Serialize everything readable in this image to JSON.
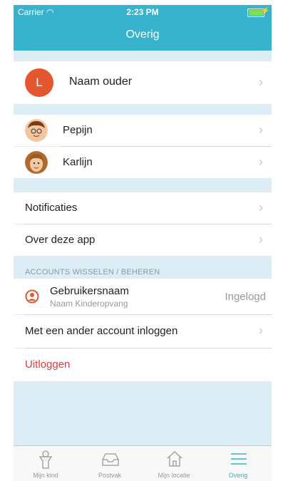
{
  "status_bar": {
    "carrier": "Carrier",
    "time": "2:23 PM"
  },
  "nav": {
    "title": "Overig"
  },
  "profile": {
    "initial": "L",
    "name": "Naam ouder"
  },
  "children": [
    {
      "name": "Pepijn",
      "avatar": "boy-avatar"
    },
    {
      "name": "Karlijn",
      "avatar": "girl-avatar"
    }
  ],
  "menu": {
    "notifications": "Notificaties",
    "about": "Over deze app"
  },
  "accounts": {
    "header": "ACCOUNTS WISSELEN / BEHEREN",
    "username": "Gebruikersnaam",
    "org": "Naam Kinderopvang",
    "status": "Ingelogd",
    "other_login": "Met een ander account inloggen",
    "logout": "Uitloggen"
  },
  "tabs": [
    {
      "label": "Mijn kind",
      "icon": "child-icon"
    },
    {
      "label": "Postvak",
      "icon": "inbox-icon"
    },
    {
      "label": "Mijn locatie",
      "icon": "home-icon"
    },
    {
      "label": "Overig",
      "icon": "menu-icon"
    }
  ],
  "colors": {
    "accent": "#37b3cd",
    "avatar": "#e4572e",
    "logout": "#e0393e",
    "background": "#dcedf5"
  }
}
